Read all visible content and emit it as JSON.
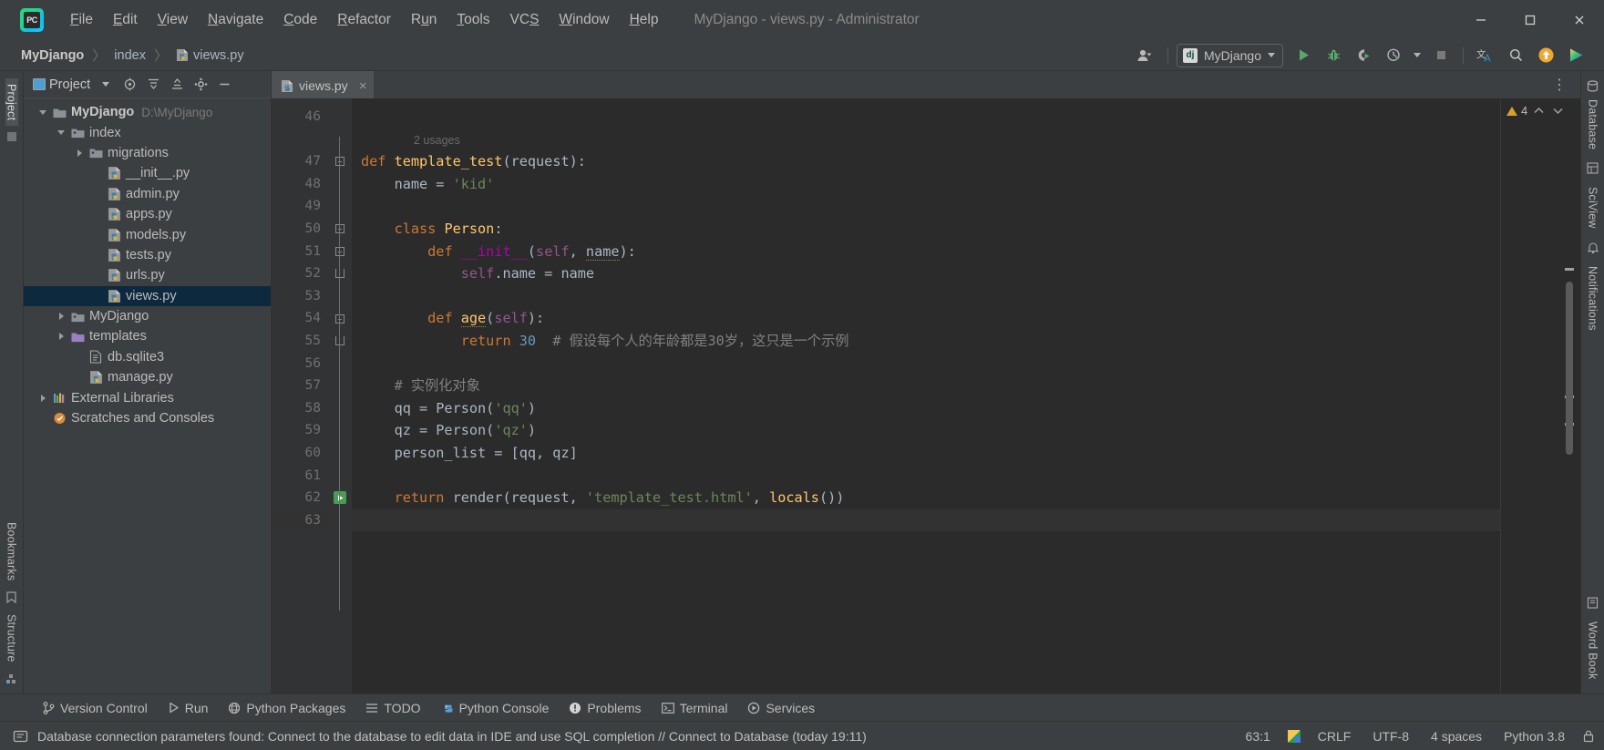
{
  "window": {
    "title": "MyDjango - views.py - Administrator",
    "controls": {
      "minimize": "minimize-icon",
      "maximize": "maximize-icon",
      "close": "close-icon"
    }
  },
  "menu": {
    "logo": "pycharm-logo",
    "items": [
      {
        "label": "File",
        "mnemonic": "F"
      },
      {
        "label": "Edit",
        "mnemonic": "E"
      },
      {
        "label": "View",
        "mnemonic": "V"
      },
      {
        "label": "Navigate",
        "mnemonic": "N"
      },
      {
        "label": "Code",
        "mnemonic": "C"
      },
      {
        "label": "Refactor",
        "mnemonic": "R"
      },
      {
        "label": "Run",
        "mnemonic": "u"
      },
      {
        "label": "Tools",
        "mnemonic": "T"
      },
      {
        "label": "VCS",
        "mnemonic": "S"
      },
      {
        "label": "Window",
        "mnemonic": "W"
      },
      {
        "label": "Help",
        "mnemonic": "H"
      }
    ]
  },
  "breadcrumb": {
    "items": [
      {
        "label": "MyDjango",
        "bold": true,
        "icon": ""
      },
      {
        "label": "index",
        "bold": false,
        "icon": ""
      },
      {
        "label": "views.py",
        "bold": false,
        "icon": "python-file-icon"
      }
    ],
    "separator": "〉"
  },
  "toolbar": {
    "account_icon": "user-account-icon",
    "run_config": {
      "label": "MyDjango",
      "icon": "django-icon"
    },
    "buttons": [
      {
        "name": "run-button",
        "icon": "play-icon",
        "label": "Run"
      },
      {
        "name": "debug-button",
        "icon": "bug-icon",
        "label": "Debug"
      },
      {
        "name": "coverage-button",
        "icon": "coverage-icon",
        "label": "Run with Coverage"
      },
      {
        "name": "profile-button",
        "icon": "profile-icon",
        "label": "Profile"
      },
      {
        "name": "stop-button",
        "icon": "stop-icon",
        "label": "Stop"
      },
      {
        "name": "translate-button",
        "icon": "translate-icon",
        "label": "Translate"
      },
      {
        "name": "search-button",
        "icon": "search-icon",
        "label": "Search Everywhere"
      },
      {
        "name": "update-button",
        "icon": "update-arrow-icon",
        "label": "Update"
      },
      {
        "name": "plugin-button",
        "icon": "colorful-play-icon",
        "label": "Plugin"
      }
    ]
  },
  "project_panel": {
    "title": "Project",
    "header_buttons": [
      {
        "name": "panel-dropdown",
        "icon": "chevron-down-icon"
      },
      {
        "name": "locate-button",
        "icon": "target-icon"
      },
      {
        "name": "expand-all-button",
        "icon": "expand-all-icon"
      },
      {
        "name": "collapse-all-button",
        "icon": "collapse-all-icon"
      },
      {
        "name": "settings-button",
        "icon": "gear-icon"
      },
      {
        "name": "hide-button",
        "icon": "minus-icon"
      }
    ],
    "tree": [
      {
        "label": "MyDjango",
        "path": "D:\\MyDjango",
        "depth": 0,
        "icon": "folder-icon",
        "state": "open",
        "bold": true,
        "selected": false
      },
      {
        "label": "index",
        "path": "",
        "depth": 1,
        "icon": "module-folder-icon",
        "state": "open",
        "bold": false,
        "selected": false
      },
      {
        "label": "migrations",
        "path": "",
        "depth": 2,
        "icon": "module-folder-icon",
        "state": "closed",
        "bold": false,
        "selected": false
      },
      {
        "label": "__init__.py",
        "path": "",
        "depth": 3,
        "icon": "python-file-icon",
        "state": "leaf",
        "bold": false,
        "selected": false
      },
      {
        "label": "admin.py",
        "path": "",
        "depth": 3,
        "icon": "python-file-icon",
        "state": "leaf",
        "bold": false,
        "selected": false
      },
      {
        "label": "apps.py",
        "path": "",
        "depth": 3,
        "icon": "python-file-icon",
        "state": "leaf",
        "bold": false,
        "selected": false
      },
      {
        "label": "models.py",
        "path": "",
        "depth": 3,
        "icon": "python-file-icon",
        "state": "leaf",
        "bold": false,
        "selected": false
      },
      {
        "label": "tests.py",
        "path": "",
        "depth": 3,
        "icon": "python-file-icon",
        "state": "leaf",
        "bold": false,
        "selected": false
      },
      {
        "label": "urls.py",
        "path": "",
        "depth": 3,
        "icon": "python-file-icon",
        "state": "leaf",
        "bold": false,
        "selected": false
      },
      {
        "label": "views.py",
        "path": "",
        "depth": 3,
        "icon": "python-file-icon",
        "state": "leaf",
        "bold": false,
        "selected": true
      },
      {
        "label": "MyDjango",
        "path": "",
        "depth": 1,
        "icon": "module-folder-icon",
        "state": "closed",
        "bold": false,
        "selected": false
      },
      {
        "label": "templates",
        "path": "",
        "depth": 1,
        "icon": "templates-folder-icon",
        "state": "closed",
        "bold": false,
        "selected": false
      },
      {
        "label": "db.sqlite3",
        "path": "",
        "depth": 2,
        "icon": "file-icon",
        "state": "leaf",
        "bold": false,
        "selected": false
      },
      {
        "label": "manage.py",
        "path": "",
        "depth": 2,
        "icon": "python-file-icon",
        "state": "leaf",
        "bold": false,
        "selected": false
      },
      {
        "label": "External Libraries",
        "path": "",
        "depth": 0,
        "icon": "libraries-icon",
        "state": "closed",
        "bold": false,
        "selected": false
      },
      {
        "label": "Scratches and Consoles",
        "path": "",
        "depth": 0,
        "icon": "scratches-icon",
        "state": "leaf",
        "bold": false,
        "selected": false
      }
    ]
  },
  "left_rail": {
    "top": "Project",
    "bookmarks": "Bookmarks",
    "structure": "Structure"
  },
  "right_rail": {
    "items": [
      "Database",
      "SciView",
      "Notifications",
      "Word Book"
    ]
  },
  "editor": {
    "tabs": [
      {
        "label": "views.py",
        "icon": "python-file-icon",
        "active": true,
        "close": "×"
      }
    ],
    "more_button": "⋮",
    "first_line_number": 46,
    "caret_line": 63,
    "inspection": {
      "warning_count": "4",
      "up": "⌃",
      "down": "⌄"
    },
    "lines": [
      {
        "n": 46,
        "tokens": []
      },
      {
        "n": null,
        "usages": "2 usages"
      },
      {
        "n": 47,
        "fold": "start",
        "tokens": [
          {
            "t": "def ",
            "c": "kw"
          },
          {
            "t": "template_test",
            "c": "fn"
          },
          {
            "t": "(request):",
            "c": "pn"
          }
        ]
      },
      {
        "n": 48,
        "tokens": [
          {
            "t": "    name = ",
            "c": "pn"
          },
          {
            "t": "'kid'",
            "c": "str"
          }
        ]
      },
      {
        "n": 49,
        "tokens": []
      },
      {
        "n": 50,
        "fold": "start",
        "tokens": [
          {
            "t": "    ",
            "c": "pn"
          },
          {
            "t": "class ",
            "c": "kw"
          },
          {
            "t": "Person",
            "c": "fn"
          },
          {
            "t": ":",
            "c": "pn"
          }
        ]
      },
      {
        "n": 51,
        "fold": "start",
        "tokens": [
          {
            "t": "        ",
            "c": "pn"
          },
          {
            "t": "def ",
            "c": "kw"
          },
          {
            "t": "__init__",
            "c": "magic"
          },
          {
            "t": "(",
            "c": "pn"
          },
          {
            "t": "self",
            "c": "self"
          },
          {
            "t": ", ",
            "c": "pn"
          },
          {
            "t": "name",
            "c": "warnu"
          },
          {
            "t": "):",
            "c": "pn"
          }
        ]
      },
      {
        "n": 52,
        "fold": "end",
        "tokens": [
          {
            "t": "            ",
            "c": "pn"
          },
          {
            "t": "self",
            "c": "self"
          },
          {
            "t": ".name = name",
            "c": "pn"
          }
        ]
      },
      {
        "n": 53,
        "tokens": []
      },
      {
        "n": 54,
        "fold": "start",
        "tokens": [
          {
            "t": "        ",
            "c": "pn"
          },
          {
            "t": "def ",
            "c": "kw"
          },
          {
            "t": "age",
            "c": "fnwarn"
          },
          {
            "t": "(",
            "c": "pn"
          },
          {
            "t": "self",
            "c": "self"
          },
          {
            "t": "):",
            "c": "pn"
          }
        ]
      },
      {
        "n": 55,
        "fold": "end",
        "tokens": [
          {
            "t": "            ",
            "c": "pn"
          },
          {
            "t": "return ",
            "c": "kw"
          },
          {
            "t": "30",
            "c": "num"
          },
          {
            "t": "  # 假设每个人的年龄都是30岁，这只是一个示例",
            "c": "cmt"
          }
        ]
      },
      {
        "n": 56,
        "tokens": []
      },
      {
        "n": 57,
        "tokens": [
          {
            "t": "    # 实例化对象",
            "c": "cmt"
          }
        ]
      },
      {
        "n": 58,
        "tokens": [
          {
            "t": "    qq = Person(",
            "c": "pn"
          },
          {
            "t": "'qq'",
            "c": "str"
          },
          {
            "t": ")",
            "c": "pn"
          }
        ]
      },
      {
        "n": 59,
        "tokens": [
          {
            "t": "    qz = Person(",
            "c": "pn"
          },
          {
            "t": "'qz'",
            "c": "str"
          },
          {
            "t": ")",
            "c": "pn"
          }
        ]
      },
      {
        "n": 60,
        "tokens": [
          {
            "t": "    person_list = [qq, qz]",
            "c": "pn"
          }
        ]
      },
      {
        "n": 61,
        "tokens": []
      },
      {
        "n": 62,
        "runmark": true,
        "fold": "end",
        "tokens": [
          {
            "t": "    ",
            "c": "pn"
          },
          {
            "t": "return ",
            "c": "kw"
          },
          {
            "t": "render(request, ",
            "c": "pn"
          },
          {
            "t": "'template_test.html'",
            "c": "str"
          },
          {
            "t": ", ",
            "c": "pn"
          },
          {
            "t": "locals",
            "c": "fn"
          },
          {
            "t": "())",
            "c": "pn"
          }
        ]
      },
      {
        "n": 63,
        "caret": true,
        "tokens": []
      }
    ]
  },
  "bottom_bar": {
    "items": [
      {
        "label": "Version Control",
        "icon": "branch-icon"
      },
      {
        "label": "Run",
        "icon": "play-icon"
      },
      {
        "label": "Python Packages",
        "icon": "package-icon"
      },
      {
        "label": "TODO",
        "icon": "list-icon"
      },
      {
        "label": "Python Console",
        "icon": "python-icon"
      },
      {
        "label": "Problems",
        "icon": "problems-icon"
      },
      {
        "label": "Terminal",
        "icon": "terminal-icon"
      },
      {
        "label": "Services",
        "icon": "services-icon"
      }
    ]
  },
  "status_bar": {
    "left_icon": "event-log-icon",
    "message": "Database connection parameters found: Connect to the database to edit data in IDE and use SQL completion // Connect to Database (today 19:11)",
    "caret_position": "63:1",
    "db_icon": "database-color-icon",
    "line_separator": "CRLF",
    "encoding": "UTF-8",
    "indent": "4 spaces",
    "interpreter": "Python 3.8",
    "lock_icon": "lock-icon"
  }
}
